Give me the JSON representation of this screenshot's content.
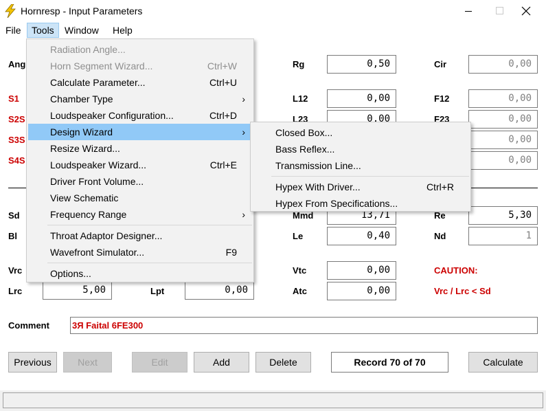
{
  "window": {
    "title": "Hornresp - Input Parameters"
  },
  "menubar": [
    {
      "label": "File"
    },
    {
      "label": "Tools"
    },
    {
      "label": "Window"
    },
    {
      "label": "Help"
    }
  ],
  "tools_menu": {
    "items": [
      {
        "label": "Radiation Angle...",
        "shortcut": "",
        "disabled": true
      },
      {
        "label": "Horn Segment Wizard...",
        "shortcut": "Ctrl+W",
        "disabled": true
      },
      {
        "label": "Calculate Parameter...",
        "shortcut": "Ctrl+U"
      },
      {
        "label": "Chamber Type",
        "shortcut": "",
        "submenu": true
      },
      {
        "label": "Loudspeaker Configuration...",
        "shortcut": "Ctrl+D"
      },
      {
        "label": "Design Wizard",
        "shortcut": "",
        "submenu": true,
        "highlighted": true
      },
      {
        "label": "Resize Wizard...",
        "shortcut": ""
      },
      {
        "label": "Loudspeaker Wizard...",
        "shortcut": "Ctrl+E"
      },
      {
        "label": "Driver Front Volume...",
        "shortcut": ""
      },
      {
        "label": "View Schematic",
        "shortcut": ""
      },
      {
        "label": "Frequency Range",
        "shortcut": "",
        "submenu": true
      },
      {
        "label": "Throat Adaptor Designer...",
        "shortcut": ""
      },
      {
        "label": "Wavefront Simulator...",
        "shortcut": "F9"
      },
      {
        "label": "Options...",
        "shortcut": ""
      }
    ],
    "submenu_arrow": "›"
  },
  "design_wizard_submenu": {
    "items": [
      {
        "label": "Closed Box...",
        "shortcut": ""
      },
      {
        "label": "Bass Reflex...",
        "shortcut": ""
      },
      {
        "label": "Transmission Line...",
        "shortcut": ""
      },
      {
        "label": "Hypex With Driver...",
        "shortcut": "Ctrl+R"
      },
      {
        "label": "Hypex From Specifications...",
        "shortcut": ""
      }
    ]
  },
  "form": {
    "left_labels": {
      "ang": "Ang",
      "s1": "S1",
      "s2": "S2S",
      "s3": "S3S",
      "s4": "S4S",
      "sd": "Sd",
      "bl": "Bl",
      "vrc": "Vrc",
      "lrc": "Lrc",
      "lpt": "Lpt"
    },
    "fields": {
      "rg": {
        "label": "Rg",
        "value": "0,50"
      },
      "cir": {
        "label": "Cir",
        "value": "0,00"
      },
      "l12": {
        "label": "L12",
        "value": "0,00"
      },
      "f12": {
        "label": "F12",
        "value": "0,00"
      },
      "l23": {
        "label": "L23",
        "value": "0,00"
      },
      "f23": {
        "label": "F23",
        "value": "0,00"
      },
      "f34_value": "0,00",
      "f45_value": "0,00",
      "mmd": {
        "label": "Mmd",
        "value": "13,71"
      },
      "re": {
        "label": "Re",
        "value": "5,30"
      },
      "le": {
        "label": "Le",
        "value": "0,40"
      },
      "nd": {
        "label": "Nd",
        "value": "1"
      },
      "vtc": {
        "label": "Vtc",
        "value": "0,00"
      },
      "atc": {
        "label": "Atc",
        "value": "0,00"
      },
      "lrc_value": "5,00",
      "lpt_value": "0,00"
    },
    "caution": {
      "title": "CAUTION:",
      "message": "Vrc / Lrc < Sd"
    },
    "comment": {
      "label": "Comment",
      "value": "3Я Faital 6FE300"
    }
  },
  "buttons": {
    "previous": "Previous",
    "next": "Next",
    "edit": "Edit",
    "add": "Add",
    "delete": "Delete",
    "record": "Record 70 of 70",
    "calculate": "Calculate"
  },
  "colors": {
    "menu_highlight": "#91c9f7",
    "menubar_active": "#cce4f7",
    "red_label": "#cc0000",
    "app_icon": "#f5c400"
  },
  "icons": {
    "app": "lightning-bolt-icon",
    "minimize": "minimize-icon",
    "maximize": "maximize-icon",
    "close": "close-icon",
    "submenu": "chevron-right-icon"
  }
}
